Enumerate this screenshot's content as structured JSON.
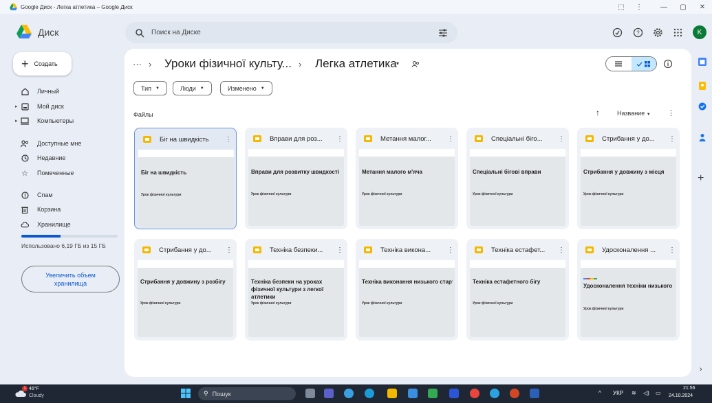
{
  "window": {
    "title": "Google Диск - Легка атлетика – Google Диск",
    "controls": [
      "—",
      "▢",
      "✕"
    ]
  },
  "header": {
    "app_name": "Диск",
    "search_placeholder": "Поиск на Диске",
    "avatar_letter": "K"
  },
  "sidebar": {
    "create_label": "Создать",
    "items": [
      {
        "label": "Личный",
        "icon": "home-icon"
      },
      {
        "label": "Мой диск",
        "icon": "drive-icon"
      },
      {
        "label": "Компьютеры",
        "icon": "computer-icon"
      },
      {
        "label": "Доступные мне",
        "icon": "shared-with-me-icon"
      },
      {
        "label": "Недавние",
        "icon": "clock-icon"
      },
      {
        "label": "Помеченные",
        "icon": "star-icon"
      },
      {
        "label": "Спам",
        "icon": "spam-icon"
      },
      {
        "label": "Корзина",
        "icon": "trash-icon"
      },
      {
        "label": "Хранилище",
        "icon": "cloud-icon"
      }
    ],
    "storage_text": "Использовано 6,19 ГБ из 15 ГБ",
    "storage_fraction": 0.41,
    "upgrade_label": "Увеличить объем хранилища"
  },
  "breadcrumb": {
    "more": "···",
    "separator": "›",
    "parent": "Уроки фізичної культу...",
    "current": "Легка атлетика",
    "caret": "▾"
  },
  "filters": [
    {
      "label": "Тип"
    },
    {
      "label": "Люди"
    },
    {
      "label": "Изменено"
    }
  ],
  "files_section": {
    "title": "Файлы",
    "sort_label": "Название",
    "sort_arrow": "↑"
  },
  "files": [
    {
      "title": "Біг на швидкість",
      "slide_title": "Біг на швидкість",
      "subtitle": "Урок фізичної культури",
      "selected": true
    },
    {
      "title": "Вправи для роз...",
      "slide_title": "Вправи для розвитку швидкості",
      "subtitle": "Урок фізичної культури",
      "selected": false
    },
    {
      "title": "Метання малог...",
      "slide_title": "Метання малого м'яча",
      "subtitle": "Урок фізичної культури",
      "selected": false
    },
    {
      "title": "Спеціальні біго...",
      "slide_title": "Спеціальні бігові вправи",
      "subtitle": "Урок фізичної культури",
      "selected": false
    },
    {
      "title": "Стрибання у до...",
      "slide_title": "Стрибання у довжину з місця",
      "subtitle": "Урок фізичної культури",
      "selected": false
    },
    {
      "title": "Стрибання у до...",
      "slide_title": "Стрибання у довжину з розбігу",
      "subtitle": "Урок фізичної культури",
      "selected": false
    },
    {
      "title": "Техніка безпеки...",
      "slide_title": "Техніка безпеки на уроках фізичної культури з легкої атлетики",
      "subtitle": "Урок фізичної культури",
      "selected": false
    },
    {
      "title": "Техніка викона...",
      "slide_title": "Техніка виконання низького старту",
      "subtitle": "Урок фізичної культури",
      "selected": false
    },
    {
      "title": "Техніка естафет...",
      "slide_title": "Техніка естафетного бігу",
      "subtitle": "Урок фізичної культури",
      "selected": false
    },
    {
      "title": "Удосконалення ...",
      "slide_title": "Удосконалення техніки низького старту",
      "subtitle": "Урок фізичної культури",
      "selected": false
    }
  ],
  "taskbar": {
    "weather_temp": "46°F",
    "weather_desc": "Cloudy",
    "weather_badge": "1",
    "search_label": "Пошук",
    "language": "УКР",
    "time": "21:56",
    "date": "24.10.2024"
  },
  "colors": {
    "accent": "#0b57d0",
    "slides": "#f5b800",
    "avatar": "#0b7a35"
  }
}
